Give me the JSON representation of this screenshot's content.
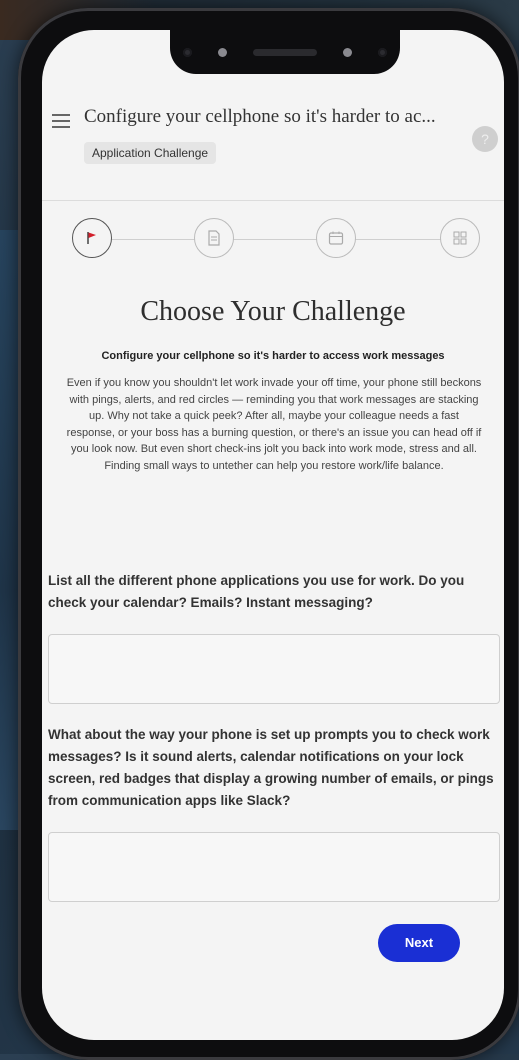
{
  "header": {
    "title": "Configure your cellphone so it's harder to ac...",
    "badge": "Application Challenge",
    "help_icon": "question-icon"
  },
  "stepper": {
    "steps": [
      {
        "icon": "flag-icon",
        "active": true
      },
      {
        "icon": "document-icon",
        "active": false
      },
      {
        "icon": "calendar-icon",
        "active": false
      },
      {
        "icon": "grid-icon",
        "active": false
      }
    ]
  },
  "content": {
    "heading": "Choose Your Challenge",
    "subheading": "Configure your cellphone so it's harder to access work messages",
    "description": "Even if you know you shouldn't let work invade your off time, your phone still beckons with pings, alerts, and red circles — reminding you that work messages are stacking up. Why not take a quick peek? After all, maybe your colleague needs a fast response, or your boss has a burning question, or there's an issue you can head off if you look now. But even short check-ins jolt you back into work mode, stress and all. Finding small ways to untether can help you restore work/life balance."
  },
  "questions": [
    {
      "label": "List all the different phone applications you use for work. Do you check your calendar? Emails? Instant messaging?",
      "value": ""
    },
    {
      "label": "What about the way your phone is set up prompts you to check work messages? Is it sound alerts, calendar notifications on your lock screen, red badges that display a growing number of emails, or pings from communication apps like Slack?",
      "value": ""
    }
  ],
  "actions": {
    "next_label": "Next"
  },
  "colors": {
    "accent": "#1a2fd4",
    "flag": "#d21f2b"
  }
}
